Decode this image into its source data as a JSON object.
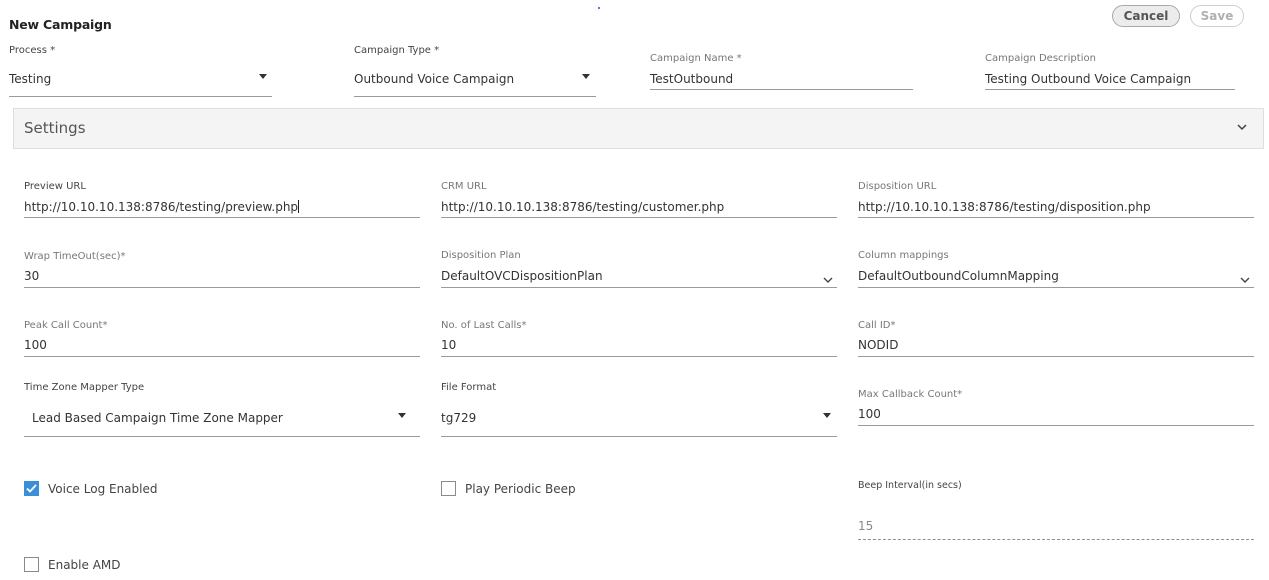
{
  "header": {
    "title": "New Campaign",
    "cancel_label": "Cancel",
    "save_label": "Save"
  },
  "top_fields": {
    "process": {
      "label": "Process *",
      "value": "Testing"
    },
    "campaign_type": {
      "label": "Campaign Type *",
      "value": "Outbound Voice Campaign"
    },
    "campaign_name": {
      "label": "Campaign Name *",
      "value": "TestOutbound"
    },
    "campaign_description": {
      "label": "Campaign Description",
      "value": "Testing Outbound Voice Campaign"
    }
  },
  "settings": {
    "title": "Settings",
    "preview_url": {
      "label": "Preview URL",
      "value": "http://10.10.10.138:8786/testing/preview.php"
    },
    "crm_url": {
      "label": "CRM URL",
      "value": "http://10.10.10.138:8786/testing/customer.php"
    },
    "disposition_url": {
      "label": "Disposition URL",
      "value": "http://10.10.10.138:8786/testing/disposition.php"
    },
    "wrap_timeout": {
      "label": "Wrap TimeOut(sec)*",
      "value": "30"
    },
    "disposition_plan": {
      "label": "Disposition Plan",
      "value": "DefaultOVCDispositionPlan"
    },
    "column_mappings": {
      "label": "Column mappings",
      "value": "DefaultOutboundColumnMapping"
    },
    "peak_call_count": {
      "label": "Peak Call Count*",
      "value": "100"
    },
    "last_calls": {
      "label": "No. of Last Calls*",
      "value": "10"
    },
    "call_id": {
      "label": "Call ID*",
      "value": "NODID"
    },
    "time_zone_mapper": {
      "label": "Time Zone Mapper Type",
      "value": "Lead Based Campaign Time Zone Mapper"
    },
    "file_format": {
      "label": "File Format",
      "value": "tg729"
    },
    "max_callback": {
      "label": "Max Callback Count*",
      "value": "100"
    },
    "voice_log": {
      "label": "Voice Log Enabled",
      "checked": true
    },
    "periodic_beep": {
      "label": "Play Periodic Beep",
      "checked": false
    },
    "beep_interval": {
      "label": "Beep Interval(in secs)",
      "value": "15"
    },
    "enable_amd": {
      "label": "Enable AMD",
      "checked": false
    }
  },
  "colors": {
    "accent": "#3b8fd9",
    "underline": "#9a9a9a",
    "panel": "#f4f4f4"
  }
}
